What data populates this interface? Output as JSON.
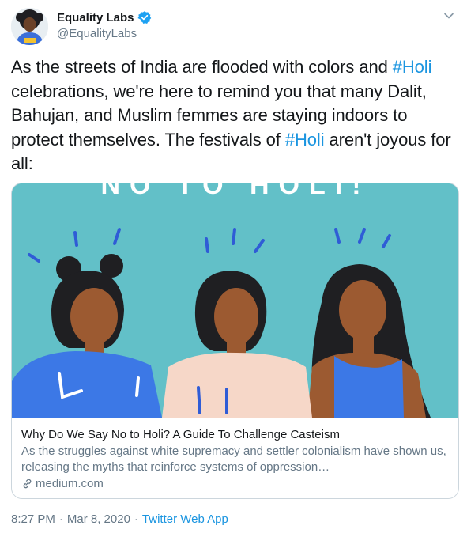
{
  "user": {
    "display_name": "Equality Labs",
    "handle": "@EqualityLabs",
    "verified": true
  },
  "icons": {
    "verified": "verified-badge-icon",
    "caret": "chevron-down-icon",
    "link": "link-icon"
  },
  "tweet": {
    "text_1": "As the streets of India are flooded with colors and ",
    "hashtag_1": "#Holi",
    "text_2": " celebrations, we're here to remind you that many Dalit, Bahujan, and Muslim femmes are staying indoors to protect themselves. The festivals of ",
    "hashtag_2": "#Holi",
    "text_3": " aren't joyous for all:"
  },
  "card": {
    "image_banner": "NO TO HOLI!",
    "title": "Why Do We Say No to Holi? A Guide To Challenge Casteism",
    "description": "As the struggles against white supremacy and settler colonialism have shown us, releasing the myths that reinforce systems of oppression…",
    "domain": "medium.com"
  },
  "footer": {
    "time": "8:27 PM",
    "sep1": "·",
    "date": "Mar 8, 2020",
    "sep2": "·",
    "source": "Twitter Web App"
  },
  "colors": {
    "link": "#1b95e0",
    "secondary_text": "#657786",
    "card_image_bg": "#62c0c8",
    "border": "#ccd6dd"
  }
}
